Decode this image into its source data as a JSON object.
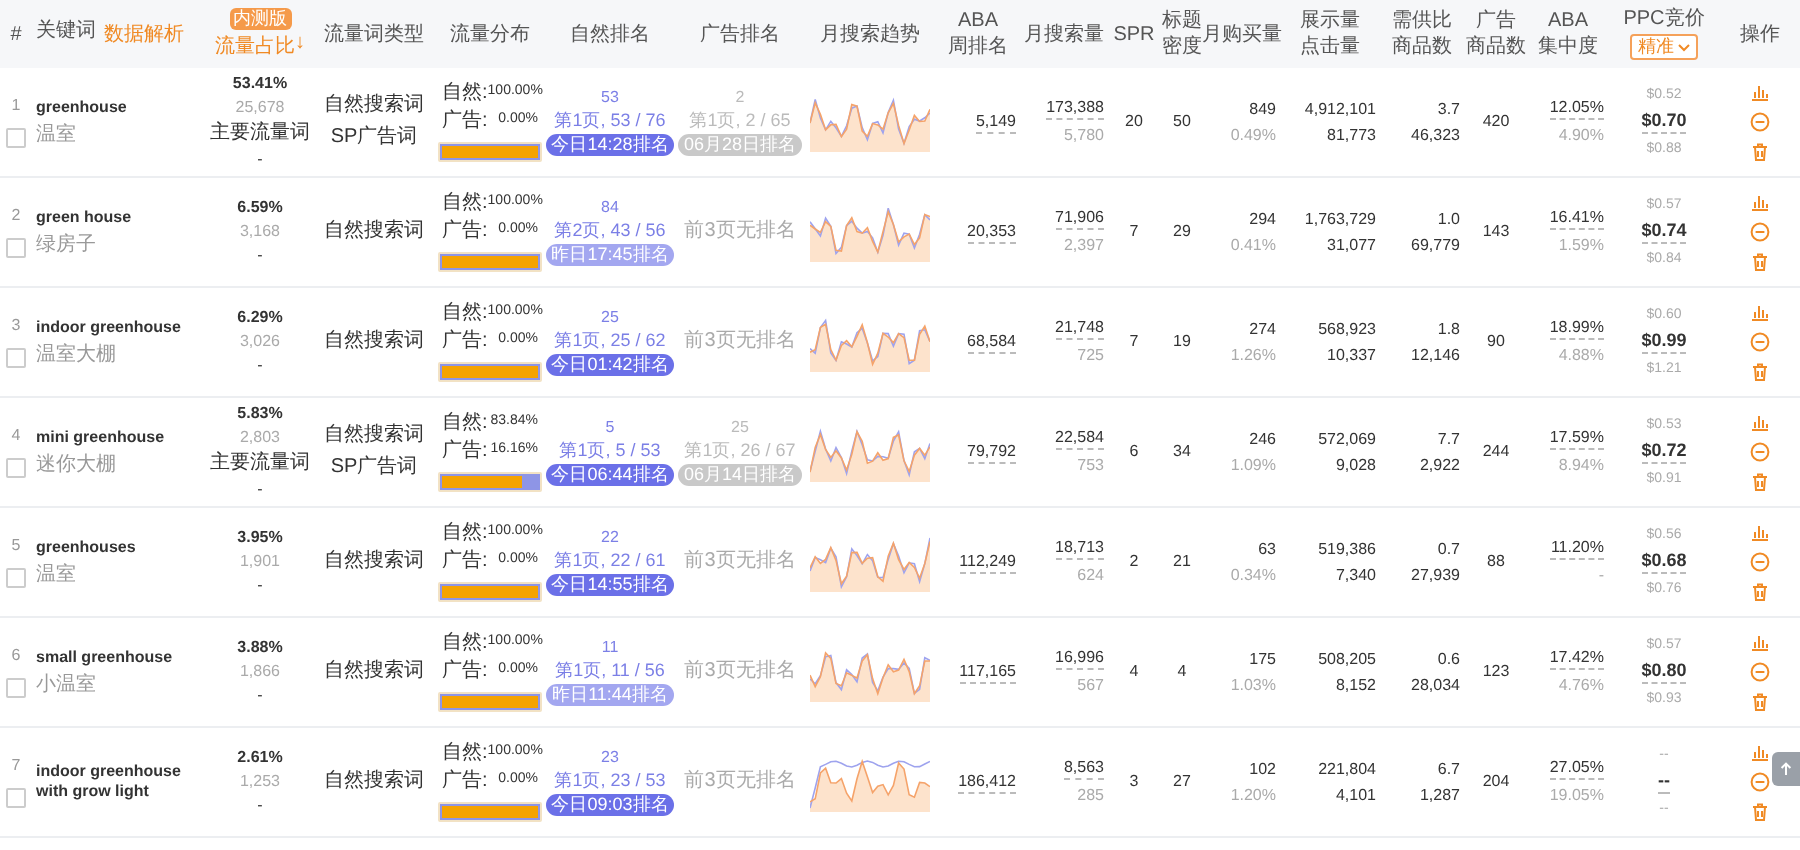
{
  "columns": [
    {
      "kind": "plain",
      "lines": [
        "#"
      ]
    },
    {
      "kind": "keyword",
      "lines": [
        "关键词"
      ],
      "link": "数据解析"
    },
    {
      "kind": "share",
      "lines": [
        "流量占比"
      ],
      "badge": "内测版",
      "sort": "↓"
    },
    {
      "kind": "plain",
      "lines": [
        "流量词类型"
      ]
    },
    {
      "kind": "plain",
      "lines": [
        "流量分布"
      ]
    },
    {
      "kind": "plain",
      "lines": [
        "自然排名"
      ]
    },
    {
      "kind": "plain",
      "lines": [
        "广告排名"
      ]
    },
    {
      "kind": "plain",
      "lines": [
        "月搜索趋势"
      ]
    },
    {
      "kind": "plain",
      "lines": [
        "ABA",
        "周排名"
      ]
    },
    {
      "kind": "plain",
      "lines": [
        "月搜索量"
      ]
    },
    {
      "kind": "plain",
      "lines": [
        "SPR"
      ]
    },
    {
      "kind": "plain",
      "lines": [
        "标题",
        "密度"
      ]
    },
    {
      "kind": "plain",
      "lines": [
        "月购买量"
      ]
    },
    {
      "kind": "plain",
      "lines": [
        "展示量",
        "点击量"
      ]
    },
    {
      "kind": "plain",
      "lines": [
        "需供比",
        "商品数"
      ]
    },
    {
      "kind": "plain",
      "lines": [
        "广告",
        "商品数"
      ]
    },
    {
      "kind": "plain",
      "lines": [
        "ABA",
        "集中度"
      ]
    },
    {
      "kind": "ppc",
      "lines": [
        "PPC竞价"
      ],
      "button": "精准"
    },
    {
      "kind": "plain",
      "lines": [
        "操作"
      ]
    }
  ],
  "rows": [
    {
      "index": "1",
      "checked": false,
      "keyword": "greenhouse",
      "translation": "温室",
      "share": "53.41%",
      "share_count": "25,678",
      "tag": "主要流量词",
      "share_extra": "-",
      "types": [
        "自然搜索词",
        "SP广告词"
      ],
      "dist_natural_label": "自然:",
      "dist_natural": "100.00%",
      "dist_ad_label": "广告:",
      "dist_ad": "0.00%",
      "level": 1,
      "natural_rank": "53",
      "natural_page": "第1页, 53 / 76",
      "natural_time": "今日14:28排名",
      "today": true,
      "ad_rank": {
        "kind": "ranked",
        "rank": "2",
        "page": "第1页, 2 / 65",
        "time": "06月28日排名"
      },
      "aba_week": "5,149",
      "month_search": "173,388",
      "month_search_sub": "5,780",
      "spr": "20",
      "density": "50",
      "buy": "849",
      "buy_rate": "0.49%",
      "impressions": "4,912,101",
      "clicks": "81,773",
      "supply_ratio": "3.7",
      "products": "46,323",
      "ad_products": "420",
      "aba_conc": "12.05%",
      "aba_conc_sub": "4.90%",
      "ppc_low": "$0.52",
      "ppc": "$0.70",
      "ppc_high": "$0.88"
    },
    {
      "index": "2",
      "checked": false,
      "keyword": "green house",
      "translation": "绿房子",
      "share": "6.59%",
      "share_count": "3,168",
      "share_extra": "-",
      "types": [
        "自然搜索词"
      ],
      "dist_natural_label": "自然:",
      "dist_natural": "100.00%",
      "dist_ad_label": "广告:",
      "dist_ad": "0.00%",
      "level": 1,
      "natural_rank": "84",
      "natural_page": "第2页, 43 / 56",
      "natural_time": "昨日17:45排名",
      "today": false,
      "ad_rank": {
        "kind": "none",
        "text": "前3页无排名"
      },
      "aba_week": "20,353",
      "month_search": "71,906",
      "month_search_sub": "2,397",
      "spr": "7",
      "density": "29",
      "buy": "294",
      "buy_rate": "0.41%",
      "impressions": "1,763,729",
      "clicks": "31,077",
      "supply_ratio": "1.0",
      "products": "69,779",
      "ad_products": "143",
      "aba_conc": "16.41%",
      "aba_conc_sub": "1.59%",
      "ppc_low": "$0.57",
      "ppc": "$0.74",
      "ppc_high": "$0.84"
    },
    {
      "index": "3",
      "checked": false,
      "keyword": "indoor greenhouse",
      "translation": "温室大棚",
      "share": "6.29%",
      "share_count": "3,026",
      "share_extra": "-",
      "types": [
        "自然搜索词"
      ],
      "dist_natural_label": "自然:",
      "dist_natural": "100.00%",
      "dist_ad_label": "广告:",
      "dist_ad": "0.00%",
      "level": 1,
      "natural_rank": "25",
      "natural_page": "第1页, 25 / 62",
      "natural_time": "今日01:42排名",
      "today": true,
      "ad_rank": {
        "kind": "none",
        "text": "前3页无排名"
      },
      "aba_week": "68,584",
      "month_search": "21,748",
      "month_search_sub": "725",
      "spr": "7",
      "density": "19",
      "buy": "274",
      "buy_rate": "1.26%",
      "impressions": "568,923",
      "clicks": "10,337",
      "supply_ratio": "1.8",
      "products": "12,146",
      "ad_products": "90",
      "aba_conc": "18.99%",
      "aba_conc_sub": "4.88%",
      "ppc_low": "$0.60",
      "ppc": "$0.99",
      "ppc_high": "$1.21"
    },
    {
      "index": "4",
      "checked": false,
      "keyword": "mini greenhouse",
      "translation": "迷你大棚",
      "share": "5.83%",
      "share_count": "2,803",
      "tag": "主要流量词",
      "share_extra": "-",
      "types": [
        "自然搜索词",
        "SP广告词"
      ],
      "dist_natural_label": "自然:",
      "dist_natural": "83.84%",
      "dist_ad_label": "广告:",
      "dist_ad": "16.16%",
      "level": 0.8384,
      "natural_rank": "5",
      "natural_page": "第1页, 5 / 53",
      "natural_time": "今日06:44排名",
      "today": true,
      "ad_rank": {
        "kind": "ranked",
        "rank": "25",
        "page": "第1页, 26 / 67",
        "time": "06月14日排名"
      },
      "aba_week": "79,792",
      "month_search": "22,584",
      "month_search_sub": "753",
      "spr": "6",
      "density": "34",
      "buy": "246",
      "buy_rate": "1.09%",
      "impressions": "572,069",
      "clicks": "9,028",
      "supply_ratio": "7.7",
      "products": "2,922",
      "ad_products": "244",
      "aba_conc": "17.59%",
      "aba_conc_sub": "8.94%",
      "ppc_low": "$0.53",
      "ppc": "$0.72",
      "ppc_high": "$0.91"
    },
    {
      "index": "5",
      "checked": false,
      "keyword": "greenhouses",
      "translation": "温室",
      "share": "3.95%",
      "share_count": "1,901",
      "share_extra": "-",
      "types": [
        "自然搜索词"
      ],
      "dist_natural_label": "自然:",
      "dist_natural": "100.00%",
      "dist_ad_label": "广告:",
      "dist_ad": "0.00%",
      "level": 1,
      "natural_rank": "22",
      "natural_page": "第1页, 22 / 61",
      "natural_time": "今日14:55排名",
      "today": true,
      "ad_rank": {
        "kind": "none",
        "text": "前3页无排名"
      },
      "aba_week": "112,249",
      "month_search": "18,713",
      "month_search_sub": "624",
      "spr": "2",
      "density": "21",
      "buy": "63",
      "buy_rate": "0.34%",
      "impressions": "519,386",
      "clicks": "7,340",
      "supply_ratio": "0.7",
      "products": "27,939",
      "ad_products": "88",
      "aba_conc": "11.20%",
      "aba_conc_sub": "-",
      "ppc_low": "$0.56",
      "ppc": "$0.68",
      "ppc_high": "$0.76"
    },
    {
      "index": "6",
      "checked": false,
      "keyword": "small greenhouse",
      "translation": "小温室",
      "share": "3.88%",
      "share_count": "1,866",
      "share_extra": "-",
      "types": [
        "自然搜索词"
      ],
      "dist_natural_label": "自然:",
      "dist_natural": "100.00%",
      "dist_ad_label": "广告:",
      "dist_ad": "0.00%",
      "level": 1,
      "natural_rank": "11",
      "natural_page": "第1页, 11 / 56",
      "natural_time": "昨日11:44排名",
      "today": false,
      "ad_rank": {
        "kind": "none",
        "text": "前3页无排名"
      },
      "aba_week": "117,165",
      "month_search": "16,996",
      "month_search_sub": "567",
      "spr": "4",
      "density": "4",
      "buy": "175",
      "buy_rate": "1.03%",
      "impressions": "508,205",
      "clicks": "8,152",
      "supply_ratio": "0.6",
      "products": "28,034",
      "ad_products": "123",
      "aba_conc": "17.42%",
      "aba_conc_sub": "4.76%",
      "ppc_low": "$0.57",
      "ppc": "$0.80",
      "ppc_high": "$0.93"
    },
    {
      "index": "7",
      "checked": false,
      "keyword": "indoor greenhouse with grow light",
      "share": "2.61%",
      "share_count": "1,253",
      "share_extra": "-",
      "types": [
        "自然搜索词"
      ],
      "dist_natural_label": "自然:",
      "dist_natural": "100.00%",
      "dist_ad_label": "广告:",
      "dist_ad": "0.00%",
      "level": 1,
      "natural_rank": "23",
      "natural_page": "第1页, 23 / 53",
      "natural_time": "今日09:03排名",
      "today": true,
      "ad_rank": {
        "kind": "none",
        "text": "前3页无排名"
      },
      "aba_week": "186,412",
      "month_search": "8,563",
      "month_search_sub": "285",
      "spr": "3",
      "density": "27",
      "buy": "102",
      "buy_rate": "1.20%",
      "impressions": "221,804",
      "clicks": "4,101",
      "supply_ratio": "6.7",
      "products": "1,287",
      "ad_products": "204",
      "aba_conc": "27.05%",
      "aba_conc_sub": "19.05%",
      "ppc_low": "--",
      "ppc": "--",
      "ppc_high": "--"
    }
  ]
}
